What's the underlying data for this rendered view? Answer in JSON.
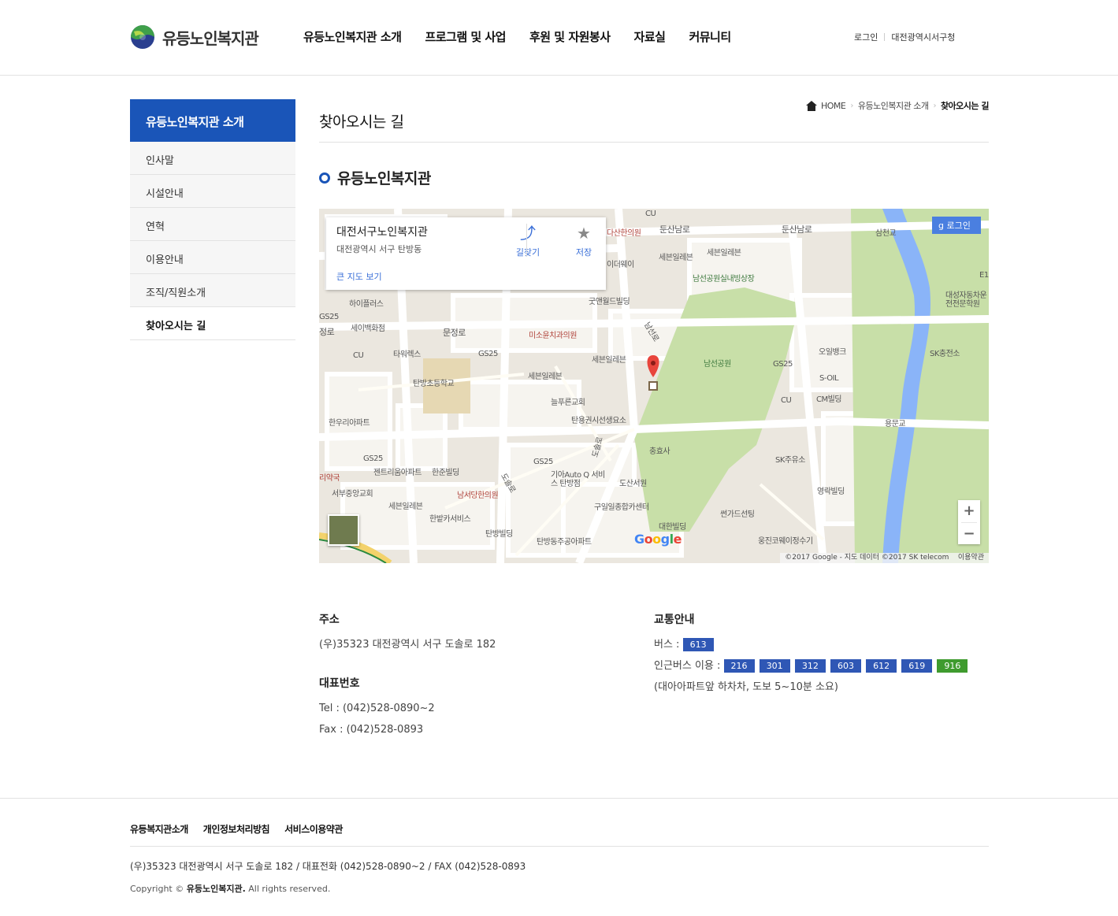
{
  "header": {
    "logo_text": "유등노인복지관",
    "nav": [
      "유등노인복지관 소개",
      "프로그램 및 사업",
      "후원 및 자원봉사",
      "자료실",
      "커뮤니티"
    ],
    "util": {
      "login": "로그인",
      "gov": "대전광역시서구청"
    }
  },
  "lnb": {
    "title": "유등노인복지관 소개",
    "items": [
      "인사말",
      "시설안내",
      "연혁",
      "이용안내",
      "조직/직원소개",
      "찾아오시는 길"
    ],
    "active_index": 5
  },
  "content": {
    "page_title": "찾아오시는 길",
    "breadcrumb": {
      "home": "HOME",
      "parent": "유등노인복지관 소개",
      "current": "찾아오시는 길"
    },
    "org_title": "유등노인복지관"
  },
  "map": {
    "card": {
      "name": "대전서구노인복지관",
      "address": "대전광역시 서구 탄방동",
      "large_map": "큰 지도 보기",
      "directions": "길찾기",
      "save": "저장"
    },
    "login": "로그인",
    "google": "Google",
    "copyright": "©2017 Google - 지도 데이터 ©2017 SK telecom",
    "terms": "이용약관",
    "labels": [
      "CU",
      "다산한의원",
      "둔산남로",
      "둔산남로",
      "삼천교",
      "세븐일레븐",
      "세븐일레븐",
      "이더웨이",
      "남선공원실내빙상장",
      "하이플러스",
      "굿앤월드빌딩",
      "GS25",
      "세이백화점",
      "문정로",
      "미소윤치과의원",
      "E1",
      "대성자동차운전전문학원",
      "타워렉스",
      "GS25",
      "세븐일레븐",
      "오일뱅크",
      "SK충전소",
      "CU",
      "탄방초등학교",
      "세븐일레븐",
      "남선공원",
      "GS25",
      "S-OIL",
      "CM빌딩",
      "늘푸른교회",
      "탄용권시선생요소",
      "CU",
      "용문교",
      "한우리아파트",
      "충효사",
      "SK주유소",
      "GS25",
      "GS25",
      "젠트리움아파트",
      "한준빌딩",
      "기아Auto Q 서비스 탄방점",
      "도산서원",
      "서부중앙교회",
      "남서당한의원",
      "영락빌딩",
      "세븐일레븐",
      "구일일종합카센터",
      "한밭카서비스",
      "썬가드선팅",
      "탄방빌딩",
      "대한빌딩",
      "탄방동주공아파트",
      "웅진코웨이정수기",
      "남선로",
      "도솔로",
      "도솔로",
      "정로",
      "리약국"
    ]
  },
  "info": {
    "address_title": "주소",
    "address": "(우)35323 대전광역시 서구 도솔로 182",
    "phone_title": "대표번호",
    "tel": "Tel : (042)528-0890~2",
    "fax": "Fax : (042)528-0893",
    "traffic_title": "교통안내",
    "bus_label": "버스 :",
    "bus": [
      "613"
    ],
    "nearby_label": "인근버스 이용 :",
    "nearby_bus": [
      "216",
      "301",
      "312",
      "603",
      "612",
      "619",
      "916"
    ],
    "note": "(대아아파트앞 하차차, 도보 5~10분 소요)"
  },
  "footer": {
    "links": [
      "유등복지관소개",
      "개인정보처리방침",
      "서비스이용약관"
    ],
    "address": "(우)35323 대전광역시 서구 도솔로 182 / 대표전화 (042)528-0890~2 / FAX (042)528-0893",
    "copy_prefix": "Copyright ©",
    "copy_name": "유등노인복지관.",
    "copy_suffix": "All rights reserved."
  },
  "colors": {
    "primary": "#1a55b8",
    "badge": "#2f57b5",
    "badge_green": "#3f9b2e",
    "park": "#c8dfa8",
    "river": "#8ab4f8"
  }
}
